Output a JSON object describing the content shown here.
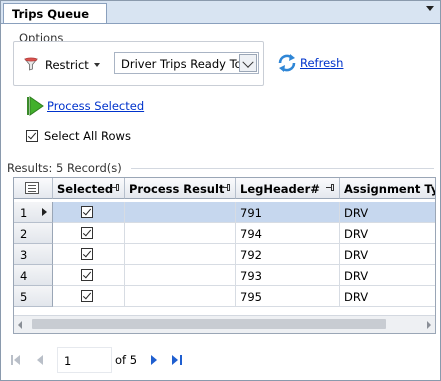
{
  "tab": {
    "title": "Trips Queue"
  },
  "options": {
    "group_label": "Options",
    "restrict_label": "Restrict",
    "select_value": "Driver Trips Ready To S"
  },
  "actions": {
    "refresh_label": "Refresh",
    "process_label": "Process Selected",
    "select_all_label": "Select All Rows"
  },
  "results": {
    "label": "Results: 5 Record(s)"
  },
  "grid": {
    "columns": [
      "Selected",
      "Process Result",
      "LegHeader#",
      "Assignment Type"
    ],
    "rows": [
      {
        "num": "1",
        "selected": true,
        "process_result": "",
        "legheader": "791",
        "assignment_type": "DRV"
      },
      {
        "num": "2",
        "selected": true,
        "process_result": "",
        "legheader": "794",
        "assignment_type": "DRV"
      },
      {
        "num": "3",
        "selected": true,
        "process_result": "",
        "legheader": "792",
        "assignment_type": "DRV"
      },
      {
        "num": "4",
        "selected": true,
        "process_result": "",
        "legheader": "793",
        "assignment_type": "DRV"
      },
      {
        "num": "5",
        "selected": true,
        "process_result": "",
        "legheader": "795",
        "assignment_type": "DRV"
      }
    ]
  },
  "navigator": {
    "page": "1",
    "of_label": "of 5"
  },
  "colors": {
    "link": "#0033cc",
    "active_row": "#c6d7ee",
    "nav_active": "#1f5fd0"
  }
}
